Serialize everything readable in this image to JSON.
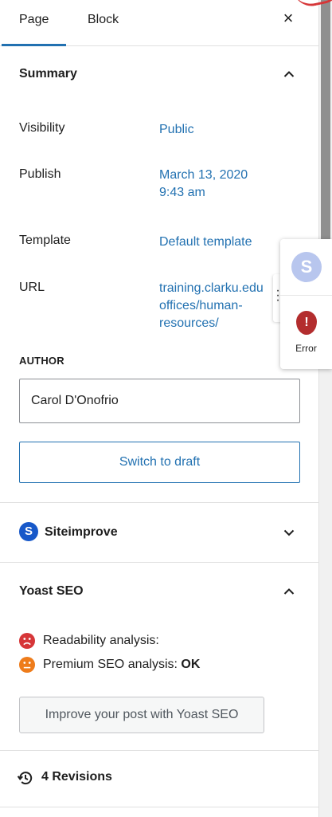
{
  "tabs": [
    {
      "label": "Page"
    },
    {
      "label": "Block"
    }
  ],
  "icons": {
    "close": "×",
    "chevron_up": "chevron-up-icon",
    "chevron_down": "chevron-down-icon",
    "revisions": "history-icon"
  },
  "summary": {
    "title": "Summary",
    "rows": [
      {
        "label": "Visibility",
        "value": "Public"
      },
      {
        "label": "Publish",
        "value_line1": "March 13, 2020",
        "value_line2": "9:43 am"
      },
      {
        "label": "Template",
        "value": "Default template"
      },
      {
        "label": "URL",
        "value_line1": "training.clarku.edu",
        "value_line2": "offices/human-",
        "value_line3": "resources/"
      }
    ],
    "author_label": "AUTHOR",
    "author_value": "Carol D'Onofrio",
    "switch_draft_label": "Switch to draft"
  },
  "siteimprove": {
    "logo_letter": "S",
    "title": "Siteimprove"
  },
  "yoast": {
    "title": "Yoast SEO",
    "readability_label": "Readability analysis:",
    "premium_label": "Premium SEO analysis:",
    "premium_status": "OK",
    "improve_label": "Improve your post with Yoast SEO"
  },
  "revisions": {
    "label": "4 Revisions"
  },
  "widget": {
    "logo_letter": "S",
    "error_symbol": "!",
    "error_label": "Error"
  },
  "colors": {
    "link": "#2271b1",
    "siteimprove_blue": "#1758c9",
    "error_red": "#b32d2e",
    "face_red": "#d63638",
    "face_orange": "#ee7c1b"
  }
}
